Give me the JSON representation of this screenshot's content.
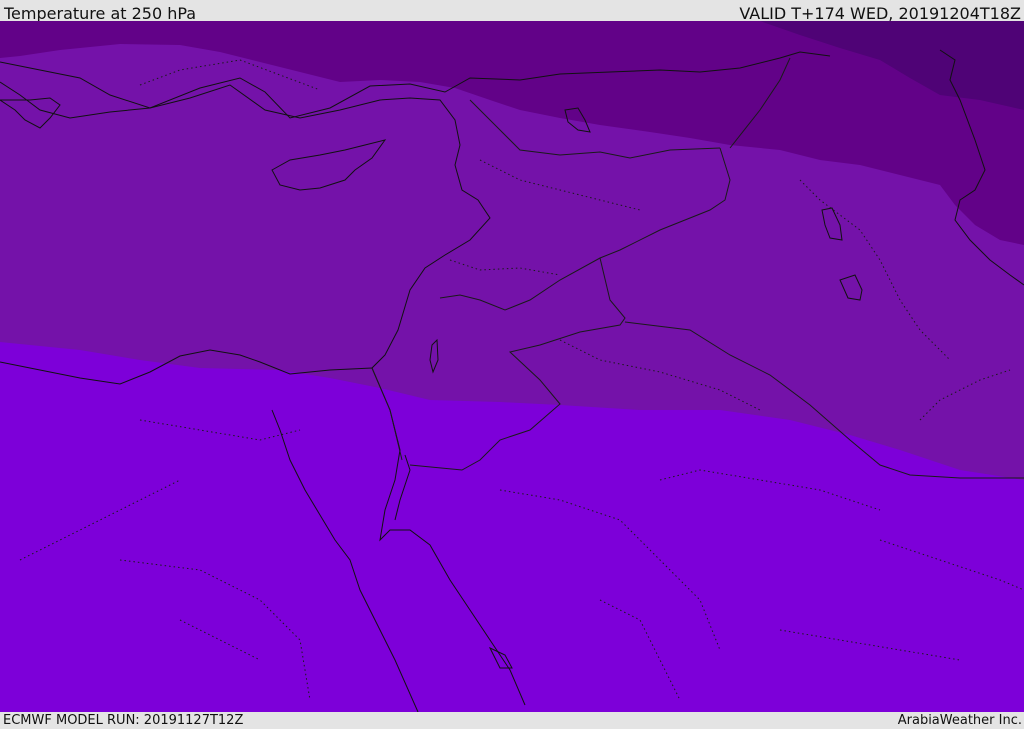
{
  "header": {
    "title": "Temperature at 250 hPa",
    "valid": "VALID T+174 WED, 20191204T18Z"
  },
  "footer": {
    "model_run": "ECMWF MODEL RUN: 20191127T12Z",
    "brand": "ArabiaWeather Inc."
  },
  "map": {
    "palette": {
      "band_coldest": "#4f0376",
      "band_cold": "#620288",
      "band_mid": "#7412a9",
      "band_warm": "#7d00d9",
      "coastline": "#111111",
      "borders": "#1a1a1a"
    }
  }
}
